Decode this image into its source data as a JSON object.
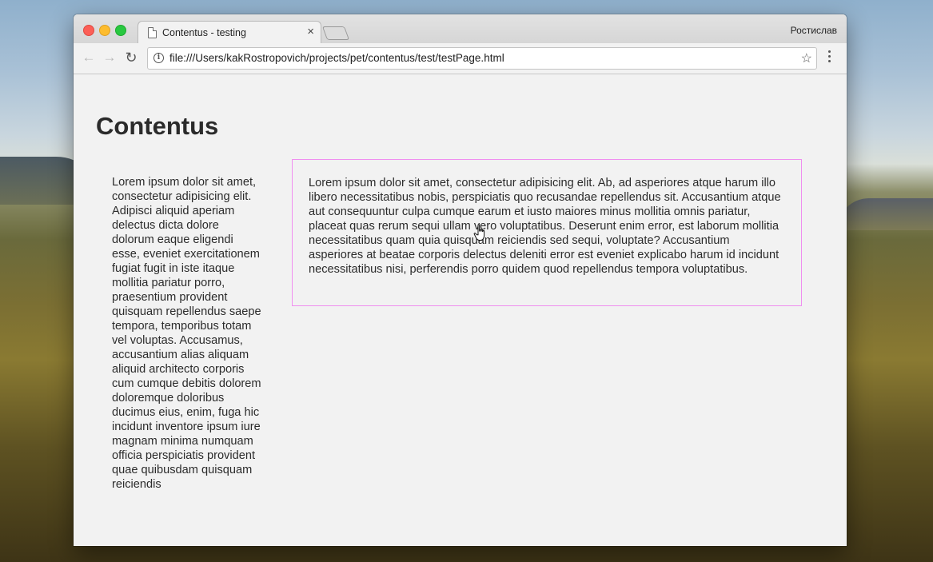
{
  "browser": {
    "tab_title": "Contentus - testing",
    "tab_close": "×",
    "profile_name": "Ростислав",
    "url": "file:///Users/kakRostropovich/projects/pet/contentus/test/testPage.html",
    "nav": {
      "back": "←",
      "forward": "→",
      "reload": "↻",
      "info": "i",
      "star": "☆"
    }
  },
  "page": {
    "heading": "Contentus",
    "sidebar_text": "Lorem ipsum dolor sit amet, consectetur adipisicing elit. Adipisci aliquid aperiam delectus dicta dolore dolorum eaque eligendi esse, eveniet exercitationem fugiat fugit in iste itaque mollitia pariatur porro, praesentium provident quisquam repellendus saepe tempora, temporibus totam vel voluptas. Accusamus, accusantium alias aliquam aliquid architecto corporis cum cumque debitis dolorem doloremque doloribus ducimus eius, enim, fuga hic incidunt inventore ipsum iure magnam minima numquam officia perspiciatis provident quae quibusdam quisquam reiciendis",
    "main_text": "Lorem ipsum dolor sit amet, consectetur adipisicing elit. Ab, ad asperiores atque harum illo libero necessitatibus nobis, perspiciatis quo recusandae repellendus sit. Accusantium atque aut consequuntur culpa cumque earum et iusto maiores minus mollitia omnis pariatur, placeat quas rerum sequi ullam vero voluptatibus. Deserunt enim error, est laborum mollitia necessitatibus quam quia quisquam reiciendis sed sequi, voluptate? Accusantium asperiores at beatae corporis delectus deleniti error est eveniet explicabo harum id incidunt necessitatibus nisi, perferendis porro quidem quod repellendus tempora voluptatibus."
  },
  "colors": {
    "highlight_border": "#f08ff0",
    "page_background": "#f2f2f2",
    "text": "#2b2b2b"
  },
  "icons": [
    "document-icon",
    "close-icon",
    "back-arrow-icon",
    "forward-arrow-icon",
    "reload-icon",
    "info-icon",
    "star-icon",
    "menu-icon",
    "hand-pointer-icon"
  ]
}
